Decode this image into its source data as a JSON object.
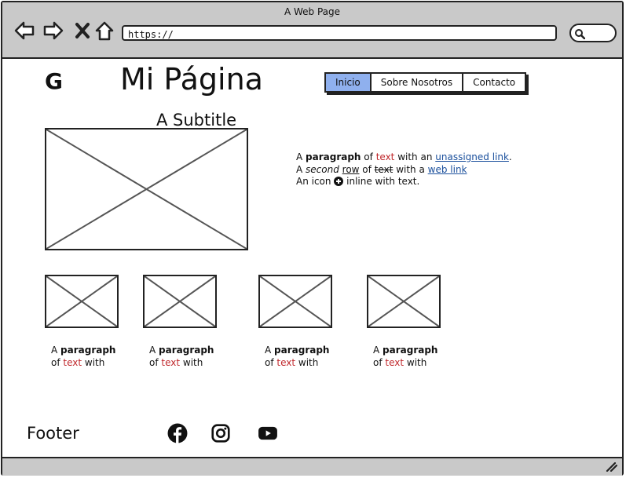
{
  "window": {
    "title": "A Web Page"
  },
  "toolbar": {
    "back_icon": "arrow-left-icon",
    "forward_icon": "arrow-right-icon",
    "close_icon": "close-icon",
    "home_icon": "home-icon",
    "url": "https://",
    "search_icon": "search-icon"
  },
  "header": {
    "logo": "G",
    "title": "Mi Página",
    "nav": [
      {
        "label": "Inicio",
        "active": true
      },
      {
        "label": "Sobre Nosotros",
        "active": false
      },
      {
        "label": "Contacto",
        "active": false
      }
    ]
  },
  "main": {
    "subtitle": "A Subtitle",
    "paragraph": {
      "line1": {
        "a": "A ",
        "bold": "paragraph",
        "b": " of ",
        "red": "text",
        "c": " with an ",
        "link": "unassigned link",
        "d": "."
      },
      "line2": {
        "a": "A ",
        "italic": "second",
        "b": " ",
        "underline": "row",
        "c": " of ",
        "strike": "text",
        "d": " with a ",
        "link": "web link"
      },
      "line3": {
        "a": "An icon ",
        "icon": "plus-circle-icon",
        "b": " inline with text."
      }
    },
    "cards": [
      {
        "a": "A ",
        "bold": "paragraph",
        "b": "of ",
        "red": "text",
        "c": " with"
      },
      {
        "a": "A ",
        "bold": "paragraph",
        "b": "of ",
        "red": "text",
        "c": " with"
      },
      {
        "a": "A ",
        "bold": "paragraph",
        "b": "of ",
        "red": "text",
        "c": " with"
      },
      {
        "a": "A ",
        "bold": "paragraph",
        "b": "of ",
        "red": "text",
        "c": " with"
      }
    ]
  },
  "footer": {
    "label": "Footer",
    "social": [
      "facebook-icon",
      "instagram-icon",
      "youtube-icon"
    ]
  },
  "colors": {
    "chrome": "#c9c9c9",
    "active_tab": "#8fb0ee",
    "red_text": "#c0282c",
    "link": "#1a4f9c"
  }
}
